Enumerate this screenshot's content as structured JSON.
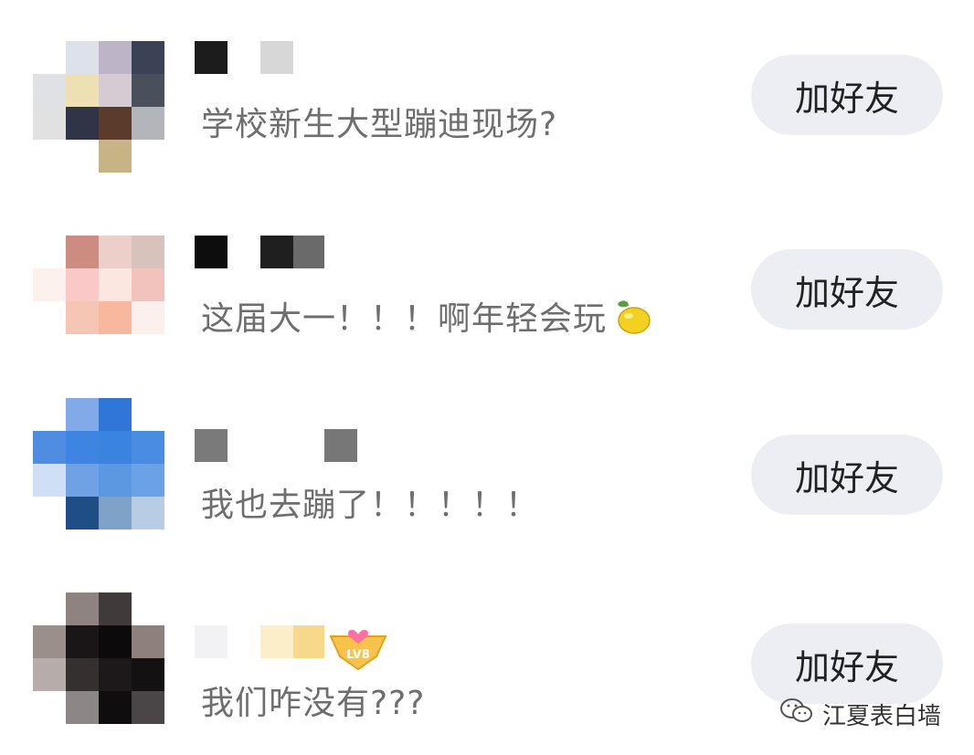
{
  "comments": [
    {
      "text": "学校新生大型蹦迪现场?",
      "button": "加好友"
    },
    {
      "text": "这届大一！！！啊年轻会玩",
      "button": "加好友"
    },
    {
      "text": "我也去蹦了！！！！！",
      "button": "加好友"
    },
    {
      "text": "我们咋没有???",
      "button": "加好友",
      "badge": "LV8"
    }
  ],
  "watermark": {
    "text": "江夏表白墙"
  },
  "icons": [
    "lemon-icon",
    "level-badge-icon",
    "wechat-icon"
  ],
  "colors": {
    "button_bg": "#eceef4",
    "comment_text": "#6e6e6e",
    "button_text": "#222222"
  }
}
